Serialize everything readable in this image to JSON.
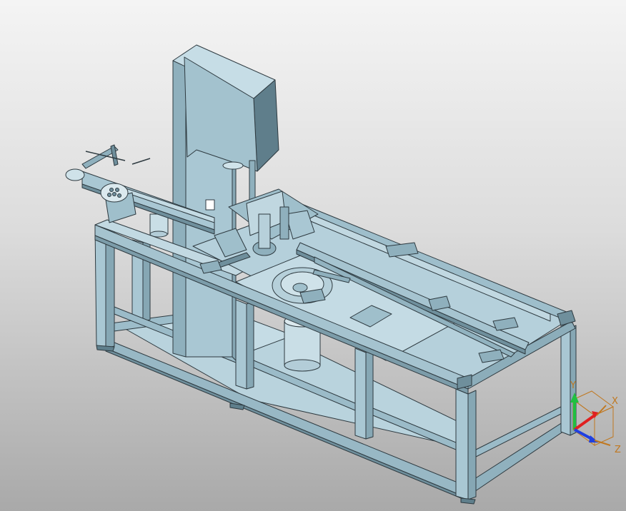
{
  "viewport": {
    "background_top": "#f4f4f4",
    "background_bottom": "#a9a9a9",
    "model_color": "#a9c7d3",
    "edge_color": "#2e3a40"
  },
  "triad": {
    "x_label": "X",
    "y_label": "Y",
    "z_label": "Z",
    "x_color": "#e02020",
    "y_color": "#20c040",
    "z_color": "#2040e0",
    "label_color": "#c07820"
  }
}
